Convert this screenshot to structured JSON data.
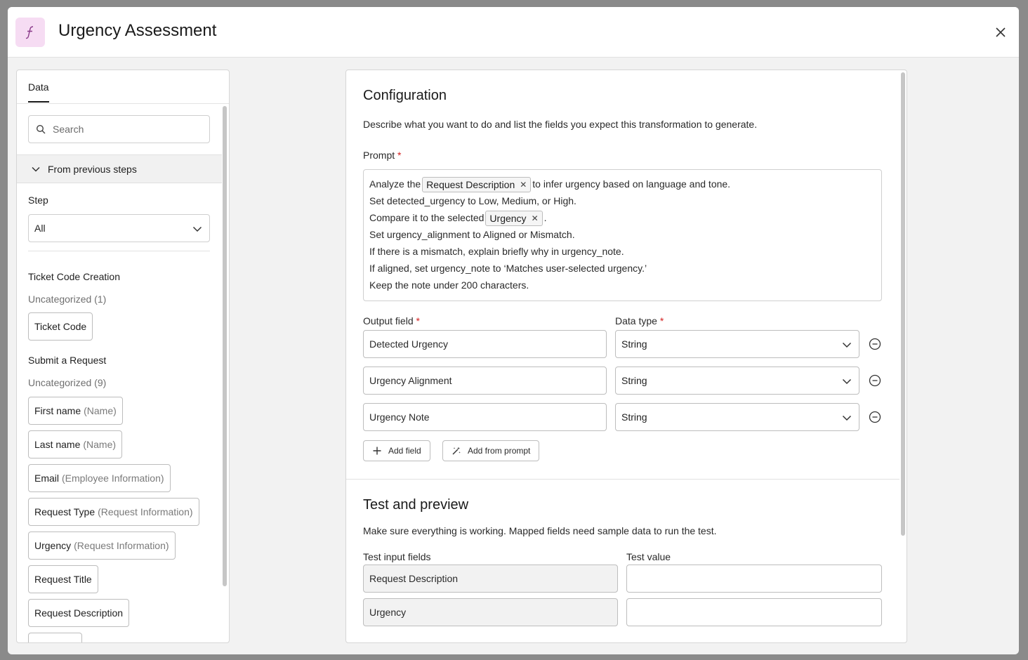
{
  "header": {
    "title": "Urgency Assessment",
    "fx_symbol": "ƒ",
    "accent": "#f6dcf3"
  },
  "left_panel": {
    "tab": "Data",
    "search": {
      "placeholder": "Search",
      "value": ""
    },
    "section": "From previous steps",
    "step_label": "Step",
    "step_value": "All",
    "groups": [
      {
        "title": "Ticket Code Creation",
        "category": "Uncategorized (1)",
        "chips": [
          {
            "label": "Ticket Code",
            "sub": ""
          }
        ]
      },
      {
        "title": "Submit a Request",
        "category": "Uncategorized (9)",
        "chips": [
          {
            "label": "First name",
            "sub": "(Name)"
          },
          {
            "label": "Last name",
            "sub": "(Name)"
          },
          {
            "label": "Email",
            "sub": "(Employee Information)"
          },
          {
            "label": "Request Type",
            "sub": "(Request Information)"
          },
          {
            "label": "Urgency",
            "sub": "(Request Information)"
          },
          {
            "label": "Request Title",
            "sub": ""
          },
          {
            "label": "Request Description",
            "sub": ""
          }
        ]
      }
    ]
  },
  "config": {
    "title": "Configuration",
    "description": "Describe what you want to do and list the fields you expect this transformation to generate.",
    "prompt_label": "Prompt",
    "required_mark": "*",
    "prompt": {
      "l1_a": "Analyze the",
      "l1_token": "Request Description",
      "l1_b": "to infer urgency based on language and tone.",
      "l2": "Set detected_urgency to Low, Medium, or High.",
      "l3_a": "Compare it to the selected",
      "l3_token": "Urgency",
      "l3_b": ".",
      "l4": "Set urgency_alignment to Aligned or Mismatch.",
      "l5": "If there is a mismatch, explain briefly why in urgency_note.",
      "l6": "If aligned, set urgency_note to ‘Matches user-selected urgency.’",
      "l7": "Keep the note under 200 characters."
    },
    "output_label": "Output field",
    "type_label": "Data type",
    "fields": [
      {
        "name": "Detected Urgency",
        "type": "String"
      },
      {
        "name": "Urgency Alignment",
        "type": "String"
      },
      {
        "name": "Urgency Note",
        "type": "String"
      }
    ],
    "add_field": "Add field",
    "add_from_prompt": "Add from prompt"
  },
  "test": {
    "title": "Test and preview",
    "description": "Make sure everything is working. Mapped fields need sample data to run the test.",
    "input_label": "Test input fields",
    "value_label": "Test value",
    "rows": [
      {
        "field": "Request Description",
        "value": ""
      },
      {
        "field": "Urgency",
        "value": ""
      }
    ]
  }
}
